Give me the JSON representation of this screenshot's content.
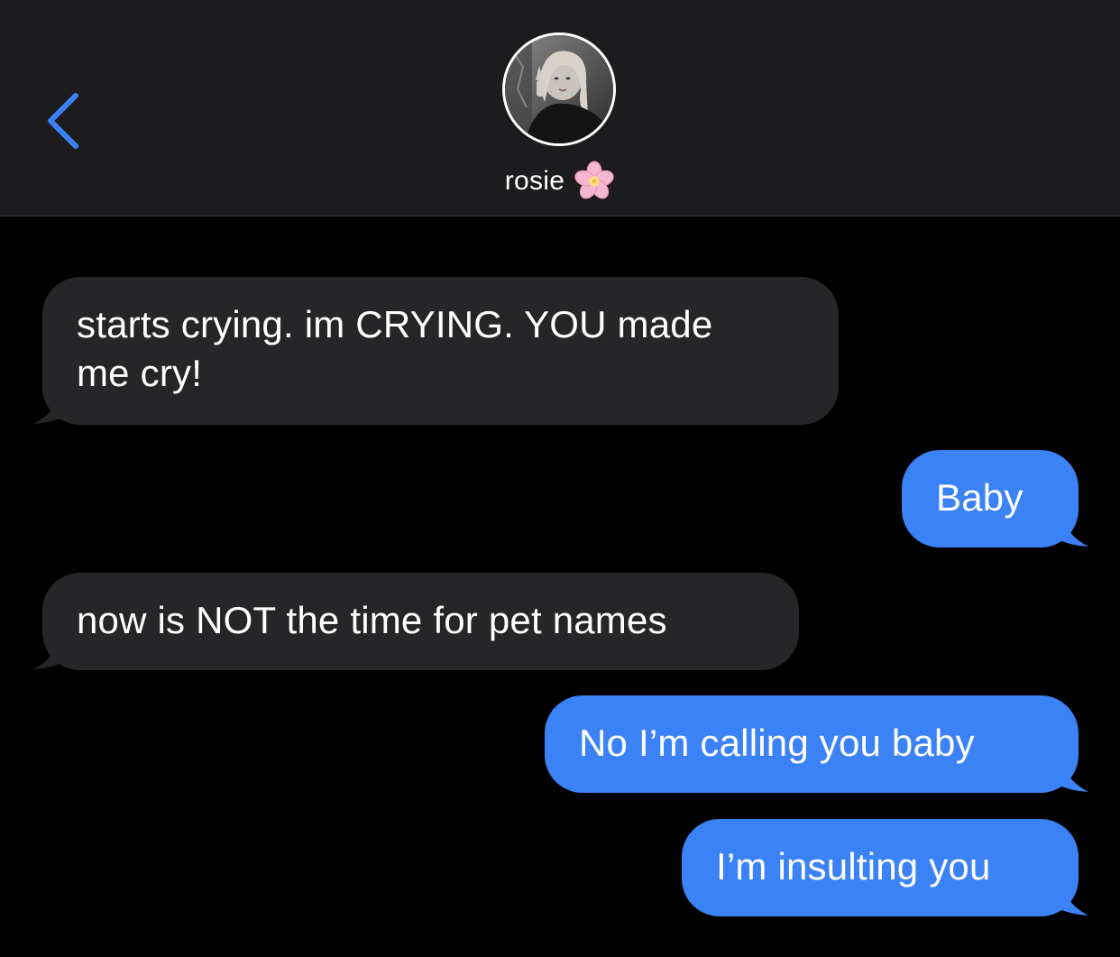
{
  "header": {
    "contact_name": "rosie",
    "name_emoji": "cherry-blossom-icon",
    "back_icon": "chevron-left-icon",
    "accent_color": "#3b82f6"
  },
  "messages": [
    {
      "direction": "incoming",
      "lines": [
        "starts crying. im CRYING. YOU made",
        "me cry!"
      ]
    },
    {
      "direction": "outgoing",
      "lines": [
        "Baby"
      ]
    },
    {
      "direction": "incoming",
      "lines": [
        "now is NOT the time for pet names"
      ]
    },
    {
      "direction": "outgoing",
      "lines": [
        "No I’m calling you baby"
      ]
    },
    {
      "direction": "outgoing",
      "lines": [
        "I’m insulting you"
      ]
    }
  ],
  "colors": {
    "incoming_bubble": "#262628",
    "outgoing_bubble": "#3b82f6",
    "header_bg": "#1c1c1e",
    "background": "#000000"
  }
}
